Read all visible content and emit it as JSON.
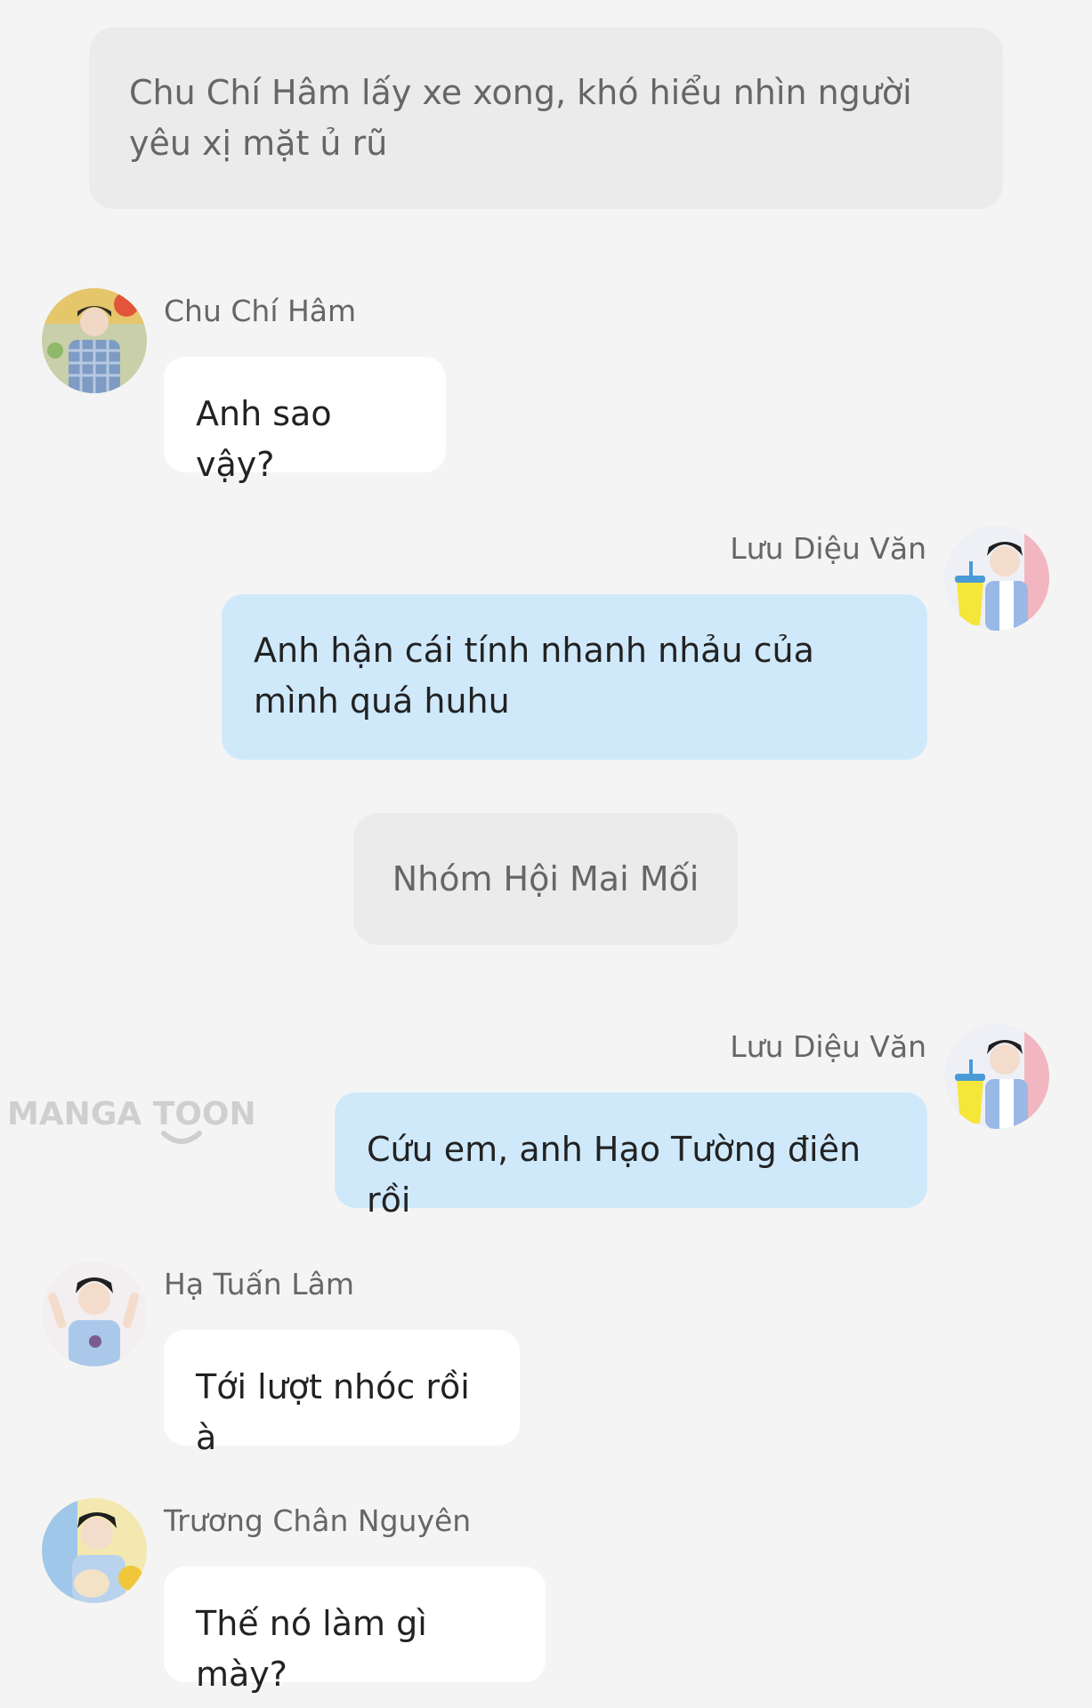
{
  "narration_top": "Chu Chí Hâm lấy xe xong, khó hiểu nhìn người yêu xị mặt ủ rũ",
  "scene_label": "Nhóm Hội Mai Mối",
  "watermark": "MANGA TOON",
  "messages": [
    {
      "sender": "Chu Chí Hâm",
      "text": "Anh sao vậy?",
      "side": "left",
      "avatar": "avatar-photo"
    },
    {
      "sender": "Lưu Diệu Văn",
      "text": "Anh hận cái tính nhanh nhảu của mình quá huhu",
      "side": "right",
      "avatar": "avatar-photo"
    },
    {
      "sender": "Lưu Diệu Văn",
      "text": "Cứu em, anh Hạo Tường điên rồi",
      "side": "right",
      "avatar": "avatar-photo"
    },
    {
      "sender": "Hạ Tuấn Lâm",
      "text": "Tới lượt nhóc rồi à",
      "side": "left",
      "avatar": "avatar-photo"
    },
    {
      "sender": "Trương Chân Nguyên",
      "text": "Thế nó làm gì mày?",
      "side": "left",
      "avatar": "avatar-photo"
    }
  ],
  "colors": {
    "background": "#f4f4f4",
    "narration_bg": "#ebebeb",
    "left_bubble": "#ffffff",
    "right_bubble": "#cfe9fb",
    "name_text": "#666666",
    "message_text": "#222222"
  }
}
